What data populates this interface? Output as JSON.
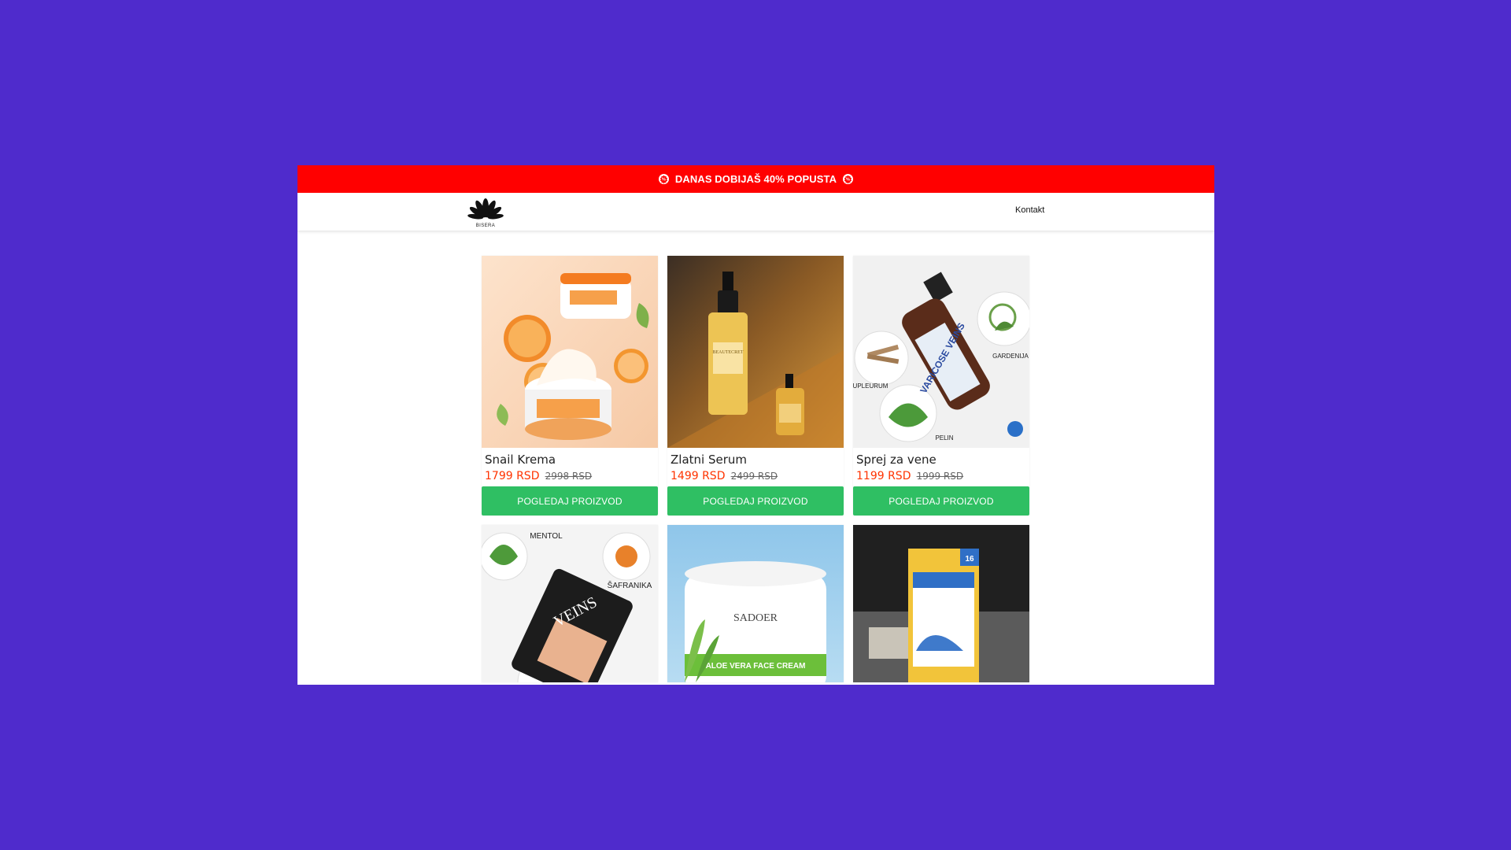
{
  "promo": {
    "text": "DANAS DOBIJAŠ 40% POPUSTA",
    "icon": "badge-percent-icon",
    "color": "#ff0000"
  },
  "header": {
    "logo_text": "BISERA",
    "nav": {
      "contact_label": "Kontakt"
    }
  },
  "colors": {
    "background": "#4f2bcc",
    "price": "#ff3300",
    "button": "#2fbf63"
  },
  "products": [
    {
      "name": "Snail Krema",
      "price": "1799 RSD",
      "old_price": "2998 RSD",
      "button_label": "POGLEDAJ PROIZVOD"
    },
    {
      "name": "Zlatni Serum",
      "price": "1499 RSD",
      "old_price": "2499 RSD",
      "button_label": "POGLEDAJ PROIZVOD",
      "image_text": {
        "brand": "BEAUTECRET"
      }
    },
    {
      "name": "Sprej za vene",
      "price": "1199 RSD",
      "old_price": "1999 RSD",
      "button_label": "POGLEDAJ PROIZVOD",
      "image_text": {
        "product": "VARICOSE VEINS",
        "label_1": "GARDENIJA",
        "label_2": "UPLEURUM",
        "label_3": "PELIN"
      }
    }
  ],
  "products_row2": [
    {
      "image_text": {
        "label_1": "MENTOL",
        "label_2": "ŠAFRANIKA",
        "product": "VEINS"
      }
    },
    {
      "image_text": {
        "brand": "SADOER",
        "product": "ALOE VERA FACE CREAM"
      }
    },
    {
      "image_text": {
        "badge": "16"
      }
    }
  ]
}
